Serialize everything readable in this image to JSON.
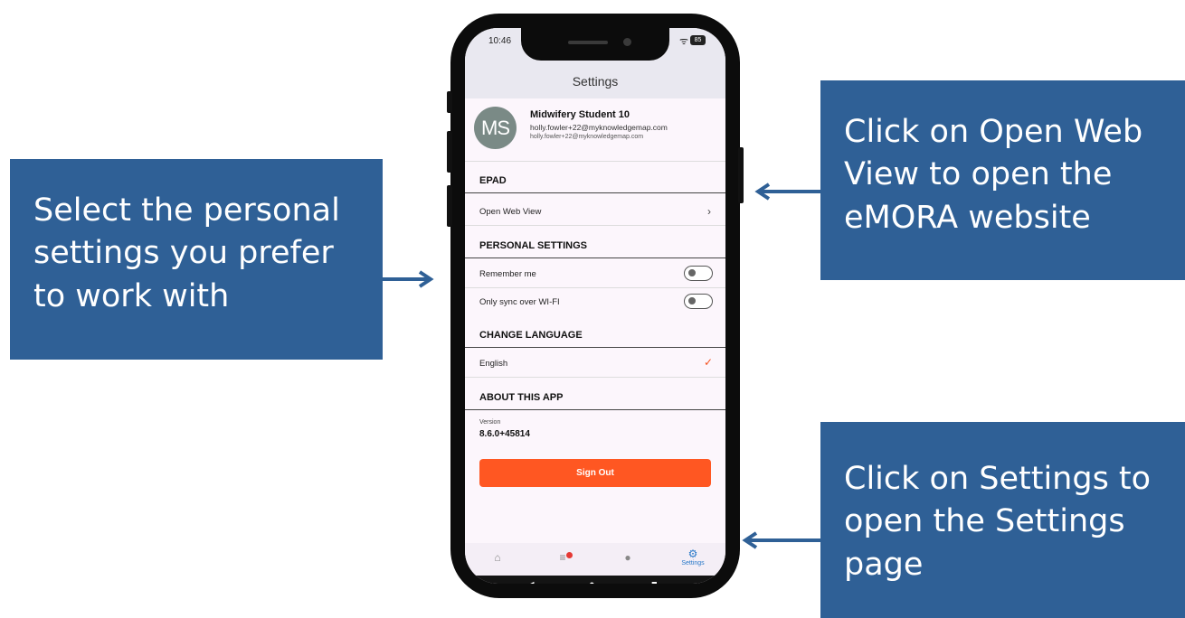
{
  "callouts": {
    "left": "Select the personal settings you prefer to work with",
    "top_right": "Click on Open Web View to open the eMORA website",
    "bottom_right": "Click on Settings to open the Settings page"
  },
  "status_bar": {
    "time": "10:46",
    "battery": "85",
    "wifi_icon": "wifi-icon"
  },
  "header": {
    "title": "Settings"
  },
  "profile": {
    "initials": "MS",
    "name": "Midwifery Student 10",
    "email_primary": "holly.fowler+22@myknowledgemap.com",
    "email_secondary": "holly.fowler+22@myknowledgemap.com"
  },
  "sections": {
    "epad": {
      "title": "EPAD",
      "open_web_view": "Open Web View"
    },
    "personal": {
      "title": "PERSONAL SETTINGS",
      "remember_me": "Remember me",
      "remember_me_on": false,
      "sync_wifi": "Only sync over WI-FI",
      "sync_wifi_on": false
    },
    "language": {
      "title": "CHANGE LANGUAGE",
      "selected": "English"
    },
    "about": {
      "title": "ABOUT THIS APP",
      "version_label": "Version",
      "version_value": "8.6.0+45814"
    }
  },
  "sign_out_label": "Sign Out",
  "bottom_nav": {
    "settings_label": "Settings",
    "active": "settings"
  },
  "colors": {
    "callout": "#2f6096",
    "accent": "#ff5722",
    "nav_active": "#2979c9"
  }
}
